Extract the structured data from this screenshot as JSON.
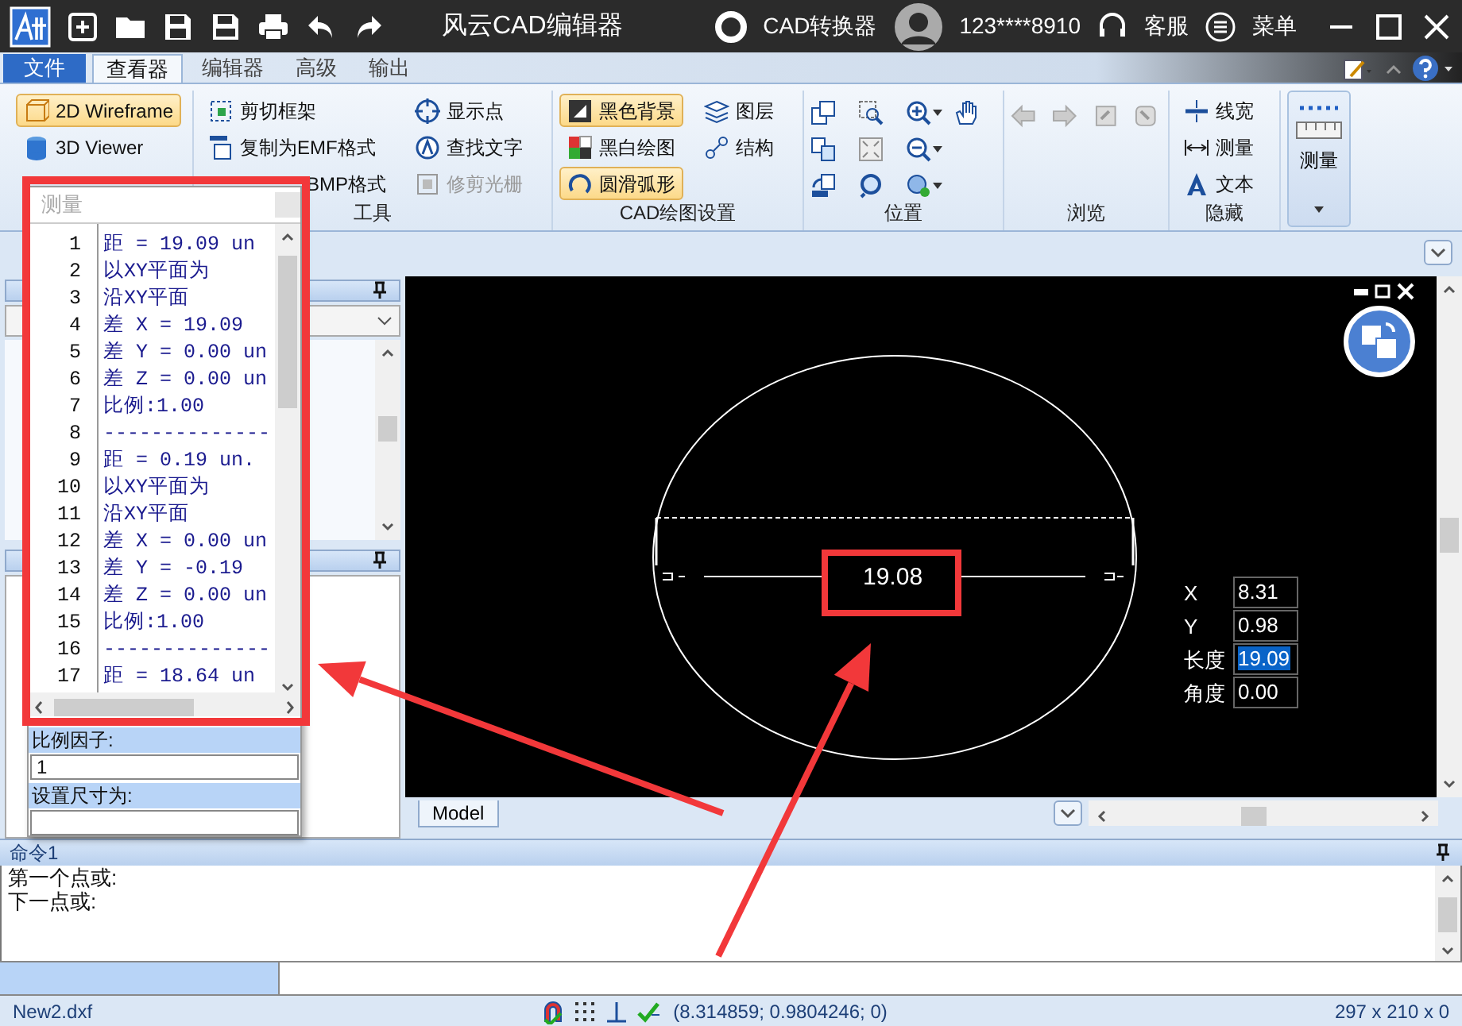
{
  "title_bar": {
    "title": "风云CAD编辑器",
    "converter": "CAD转换器",
    "account": "123****8910",
    "support": "客服",
    "menu": "菜单"
  },
  "ribbon_tabs": [
    {
      "label": "文件",
      "kind": "file",
      "selected": false
    },
    {
      "label": "查看器",
      "kind": "tab",
      "selected": true
    },
    {
      "label": "编辑器",
      "kind": "tab",
      "selected": false
    },
    {
      "label": "高级",
      "kind": "tab",
      "selected": false
    },
    {
      "label": "输出",
      "kind": "tab",
      "selected": false
    }
  ],
  "ribbon_groups": [
    {
      "kind": "list",
      "items": [
        {
          "label": "2D Wireframe",
          "on": true
        },
        {
          "label": "3D Viewer",
          "on": false
        }
      ]
    },
    {
      "kind": "list",
      "label": "工具",
      "items": [
        {
          "label": "剪切框架",
          "disabled": false
        },
        {
          "label": "复制为EMF格式",
          "disabled": false
        },
        {
          "label": "BMP格式",
          "disabled": false
        },
        {
          "label": "显示点",
          "disabled": false
        },
        {
          "label": "查找文字",
          "disabled": false
        },
        {
          "label": "修剪光栅",
          "disabled": true
        }
      ]
    },
    {
      "kind": "list",
      "label": "CAD绘图设置",
      "items": [
        {
          "label": "黑色背景",
          "on": true
        },
        {
          "label": "黑白绘图",
          "on": false
        },
        {
          "label": "圆滑弧形",
          "on": true
        },
        {
          "label": "图层",
          "on": false
        },
        {
          "label": "结构",
          "on": false
        }
      ]
    },
    {
      "kind": "position",
      "label": "位置"
    },
    {
      "kind": "browse",
      "label": "浏览"
    },
    {
      "kind": "list",
      "label": "隐藏",
      "items": [
        {
          "label": "线宽"
        },
        {
          "label": "测量"
        },
        {
          "label": "文本"
        }
      ]
    },
    {
      "kind": "big",
      "label": "测量"
    }
  ],
  "measure_window": {
    "title": "测量",
    "lines": [
      {
        "number": "1",
        "text": "距 = 19.09 un"
      },
      {
        "number": "2",
        "text": "以XY平面为"
      },
      {
        "number": "3",
        "text": "沿XY平面"
      },
      {
        "number": "4",
        "text": "差 X = 19.09"
      },
      {
        "number": "5",
        "text": "差 Y = 0.00 un"
      },
      {
        "number": "6",
        "text": "差 Z = 0.00 un"
      },
      {
        "number": "7",
        "text": "比例:1.00"
      },
      {
        "number": "8",
        "text": "--------------"
      },
      {
        "number": "9",
        "text": "距 = 0.19 un."
      },
      {
        "number": "10",
        "text": "以XY平面为"
      },
      {
        "number": "11",
        "text": "沿XY平面"
      },
      {
        "number": "12",
        "text": "差 X = 0.00 un"
      },
      {
        "number": "13",
        "text": "差 Y = -0.19"
      },
      {
        "number": "14",
        "text": "差 Z = 0.00 un"
      },
      {
        "number": "15",
        "text": "比例:1.00"
      },
      {
        "number": "16",
        "text": "--------------"
      },
      {
        "number": "17",
        "text": "距 = 18.64 un"
      }
    ],
    "fields": [
      {
        "label": "比例因子:",
        "value": "1"
      },
      {
        "label": "设置尺寸为:"
      }
    ]
  },
  "drawing": {
    "dimension_text": "19.08",
    "coordinates": [
      {
        "label": "X",
        "value": "8.31",
        "selected": false
      },
      {
        "label": "Y",
        "value": "0.98",
        "selected": false
      },
      {
        "label": "长度",
        "value": "19.09",
        "selected": true
      },
      {
        "label": "角度",
        "value": "0.00",
        "selected": false
      }
    ],
    "layout_tab": "Model"
  },
  "command_panel": {
    "title": "命令1",
    "lines": [
      "第一个点或:",
      "下一点或:"
    ]
  },
  "status_bar": {
    "file": "New2.dxf",
    "coordinates": "(8.314859; 0.9804246; 0)",
    "paper": "297 x 210 x 0"
  }
}
